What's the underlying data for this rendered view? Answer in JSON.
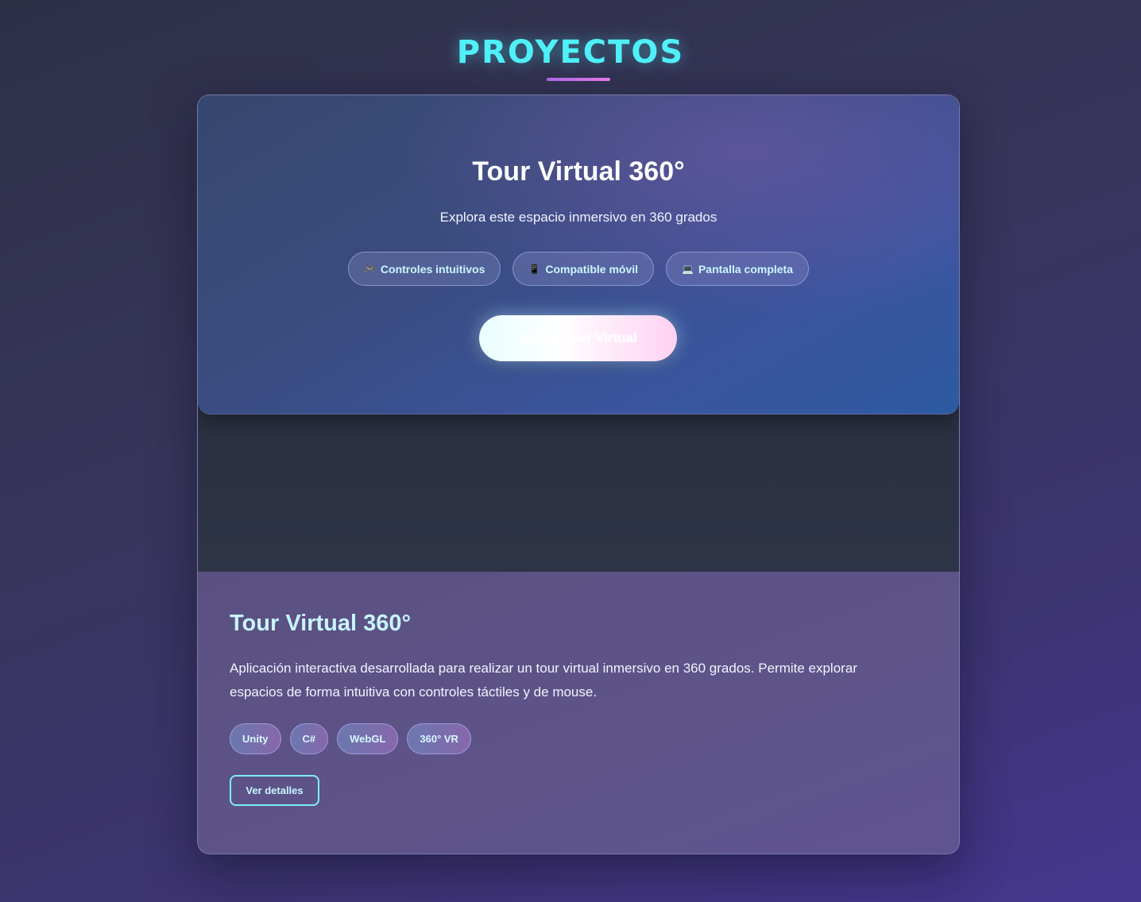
{
  "section": {
    "title": "PROYECTOS"
  },
  "tour_overlay": {
    "title": "Tour Virtual 360°",
    "subtitle": "Explora este espacio inmersivo en 360 grados",
    "features": [
      {
        "icon": "gamepad-icon",
        "glyph": "🎮",
        "label": "Controles intuitivos"
      },
      {
        "icon": "phone-icon",
        "glyph": "📱",
        "label": "Compatible móvil"
      },
      {
        "icon": "monitor-icon",
        "glyph": "💻",
        "label": "Pantalla completa"
      }
    ],
    "start_button_label": "Iniciar Tour Virtual"
  },
  "project": {
    "title": "Tour Virtual 360°",
    "description": "Aplicación interactiva desarrollada para realizar un tour virtual inmersivo en 360 grados. Permite explorar espacios de forma intuitiva con controles táctiles y de mouse.",
    "tags": [
      "Unity",
      "C#",
      "WebGL",
      "360° VR"
    ],
    "details_button_label": "Ver detalles"
  },
  "colors": {
    "accent_cyan": "#4ff0f8",
    "accent_pink": "#f07ef0",
    "card_info_bg": "#5c5485",
    "overlay_blue": "#3b55a0"
  }
}
